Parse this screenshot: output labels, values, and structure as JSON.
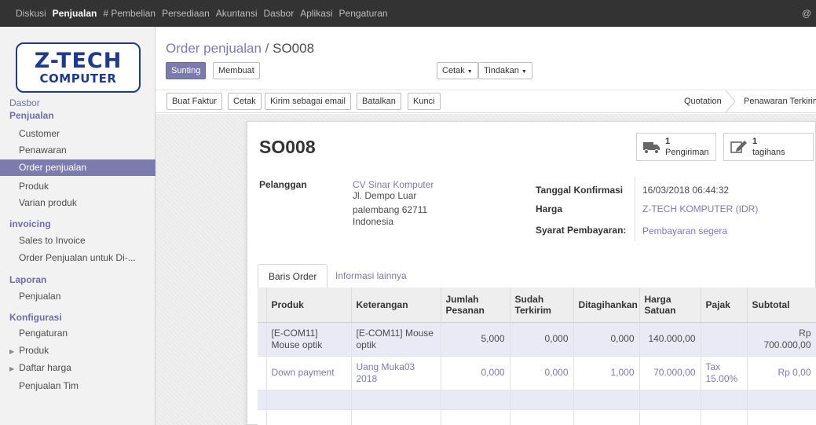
{
  "topbar": {
    "menu": [
      "Diskusi",
      "Penjualan",
      "# Pembelian",
      "Persediaan",
      "Akuntansi",
      "Dasbor",
      "Aplikasi",
      "Pengaturan"
    ],
    "active": "Penjualan",
    "user_symbol": "@"
  },
  "logo": {
    "line1": "Z-TECH",
    "line2": "COMPUTER"
  },
  "sidebar": {
    "dasbor": "Dasbor",
    "penjualan": "Penjualan",
    "penjualan_items": [
      "Customer",
      "Penawaran",
      "Order penjualan",
      "Produk",
      "Varian produk"
    ],
    "invoicing": "invoicing",
    "invoicing_items": [
      "Sales to Invoice",
      "Order Penjualan untuk Di-..."
    ],
    "laporan": "Laporan",
    "laporan_items": [
      "Penjualan"
    ],
    "konfigurasi": "Konfigurasi",
    "konfigurasi_items": [
      "Pengaturan",
      "Produk",
      "Daftar harga",
      "Penjualan Tim"
    ],
    "active_item": "Order penjualan"
  },
  "breadcrumb": {
    "parent": "Order penjualan",
    "separator": "/",
    "current": "SO008"
  },
  "controls": {
    "edit": "Sunting",
    "create": "Membuat",
    "print": "Cetak",
    "action": "Tindakan"
  },
  "statusbar": {
    "buttons": [
      "Buat Faktur",
      "Cetak",
      "Kirim sebagai email",
      "Batalkan",
      "Kunci"
    ],
    "stages": [
      "Quotation",
      "Penawaran Terkirim"
    ]
  },
  "order": {
    "name": "SO008",
    "smart_buttons": [
      {
        "count": "1",
        "label": "Pengiriman",
        "icon": "truck-icon"
      },
      {
        "count": "1",
        "label": "tagihans",
        "icon": "edit-icon"
      }
    ],
    "customer_label": "Pelanggan",
    "customer_name": "CV Sinar Komputer",
    "address": [
      "Jl. Dempo Luar",
      "palembang 62711",
      "Indonesia"
    ],
    "confirm_date_label": "Tanggal Konfirmasi",
    "confirm_date": "16/03/2018 06:44:32",
    "pricelist_label": "Harga",
    "pricelist": "Z-TECH KOMPUTER (IDR)",
    "payment_terms_label": "Syarat Pembayaran:",
    "payment_terms": "Pembayaran segera"
  },
  "tabs": [
    "Baris Order",
    "Informasi lainnya"
  ],
  "table": {
    "headers": [
      "Produk",
      "Keterangan",
      "Jumlah Pesanan",
      "Sudah Terkirim",
      "Ditagihankan",
      "Harga Satuan",
      "Pajak",
      "Subtotal"
    ],
    "rows": [
      [
        "[E-COM11] Mouse optik",
        "[E-COM11] Mouse optik",
        "5,000",
        "0,000",
        "0,000",
        "140.000,00",
        "",
        "Rp 700.000,00"
      ],
      [
        "Down payment",
        "Uang Muka03 2018",
        "0,000",
        "0,000",
        "1,000",
        "70.000,00",
        "Tax 15.00%",
        "Rp 0,00"
      ]
    ]
  },
  "colors": {
    "brand": "#7c7bad",
    "topbar": "#333333",
    "logo_blue": "#1e3a88"
  }
}
